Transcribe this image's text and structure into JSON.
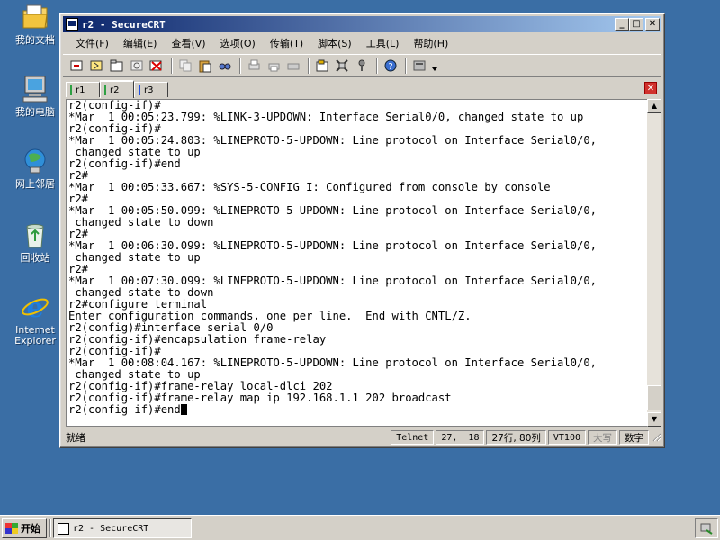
{
  "desktop": {
    "icons": [
      {
        "label": "我的文档",
        "icon": "my-documents-icon"
      },
      {
        "label": "我的电脑",
        "icon": "my-computer-icon"
      },
      {
        "label": "网上邻居",
        "icon": "network-places-icon"
      },
      {
        "label": "回收站",
        "icon": "recycle-bin-icon"
      },
      {
        "label": "Internet Explorer",
        "icon": "internet-explorer-icon"
      }
    ]
  },
  "window": {
    "title": "r2 - SecureCRT",
    "minimize": "_",
    "maximize": "□",
    "close": "✕"
  },
  "menu": [
    "文件(F)",
    "编辑(E)",
    "查看(V)",
    "选项(O)",
    "传输(T)",
    "脚本(S)",
    "工具(L)",
    "帮助(H)"
  ],
  "tabs": [
    {
      "label": "r1",
      "color": "#2ea043"
    },
    {
      "label": "r2",
      "color": "#2ea043"
    },
    {
      "label": "r3",
      "color": "#1f4ee0"
    }
  ],
  "tab_close": "✕",
  "terminal": {
    "lines": [
      "r2(config-if)#",
      "*Mar  1 00:05:23.799: %LINK-3-UPDOWN: Interface Serial0/0, changed state to up",
      "r2(config-if)#",
      "*Mar  1 00:05:24.803: %LINEPROTO-5-UPDOWN: Line protocol on Interface Serial0/0,",
      " changed state to up",
      "r2(config-if)#end",
      "r2#",
      "*Mar  1 00:05:33.667: %SYS-5-CONFIG_I: Configured from console by console",
      "r2#",
      "*Mar  1 00:05:50.099: %LINEPROTO-5-UPDOWN: Line protocol on Interface Serial0/0,",
      " changed state to down",
      "r2#",
      "*Mar  1 00:06:30.099: %LINEPROTO-5-UPDOWN: Line protocol on Interface Serial0/0,",
      " changed state to up",
      "r2#",
      "*Mar  1 00:07:30.099: %LINEPROTO-5-UPDOWN: Line protocol on Interface Serial0/0,",
      " changed state to down",
      "r2#configure terminal",
      "Enter configuration commands, one per line.  End with CNTL/Z.",
      "r2(config)#interface serial 0/0",
      "r2(config-if)#encapsulation frame-relay",
      "r2(config-if)#",
      "*Mar  1 00:08:04.167: %LINEPROTO-5-UPDOWN: Line protocol on Interface Serial0/0,",
      " changed state to up",
      "r2(config-if)#frame-relay local-dlci 202",
      "r2(config-if)#frame-relay map ip 192.168.1.1 202 broadcast",
      "r2(config-if)#end"
    ]
  },
  "status": {
    "ready": "就绪",
    "protocol": "Telnet",
    "position": "27,  18",
    "rowcol": "27行, 80列",
    "emulation": "VT100",
    "caps": "大写",
    "num": "数字"
  },
  "taskbar": {
    "start": "开始",
    "task": "r2 - SecureCRT"
  }
}
